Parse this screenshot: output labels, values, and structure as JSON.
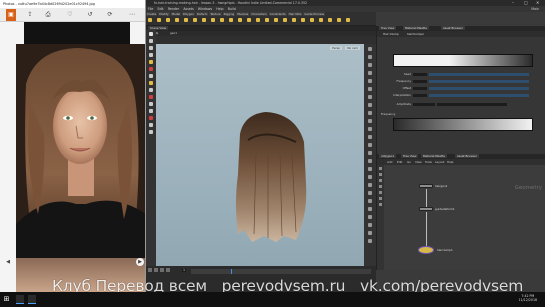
{
  "photos": {
    "title": "Photos - vuttu7ae9e7b44c8d02694202e01c92494.jpg",
    "window_buttons": [
      "–",
      "□",
      "✕"
    ],
    "toolbar_icons": [
      "folder-icon",
      "share-icon",
      "print-icon",
      "heart-icon",
      "undo-icon",
      "rotate-icon",
      "more-icon"
    ],
    "nav": [
      "◀",
      "▶"
    ]
  },
  "houdini": {
    "title": "fx-hair-training-making-hair - lesson-3 - hwngrhipb - Houdini Indie Limited-Commercial 17.0.352",
    "window_buttons": [
      "–",
      "□",
      "✕"
    ],
    "menu": [
      "File",
      "Edit",
      "Render",
      "Assets",
      "Windows",
      "Help",
      "Build"
    ],
    "menu_right": "Main",
    "shelf_tabs": [
      "Create",
      "Modify",
      "Model",
      "Polygon",
      "Deform",
      "Texture",
      "Rigging",
      "Muscles",
      "Characters",
      "Constraints",
      "Hair Utils",
      "Guide Process",
      "Guide Brushes",
      "Terrain FX",
      "Simple FX",
      "Volume"
    ],
    "viewport": {
      "tab": "Scene View",
      "path": "obj",
      "path_node": "geo1",
      "persp_label": "Persp",
      "cam_label": "No cam"
    },
    "timeline": {
      "frame": "1",
      "buttons": [
        "⏮",
        "◀",
        "▶",
        "⏭"
      ]
    },
    "params": {
      "tabs": [
        "Tree View",
        "Material Palette",
        "Asset Browser"
      ],
      "node_type": "Hair Clump",
      "node_name": "hairClumpsl",
      "rows": [
        {
          "label": "Seed",
          "value": "0"
        },
        {
          "label": "Frequency",
          "value": "1"
        },
        {
          "label": "Offset",
          "value": "0"
        },
        {
          "label": "Interpolation",
          "value": "Linear"
        },
        {
          "label": "Amplitude",
          "value": "0.35"
        }
      ],
      "section": "Frequency"
    },
    "network": {
      "tabs": [
        "/obj/geo1",
        "Tree View",
        "Material Palette",
        "Asset Browser"
      ],
      "toolbar": [
        "Add",
        "Edit",
        "Go",
        "View",
        "Tools",
        "Layout",
        "Help"
      ],
      "context_label": "Geometry",
      "nodes": [
        {
          "name": "hairgen1",
          "color": "#8c8c8c"
        },
        {
          "name": "guidedeform1",
          "color": "#8c8c8c"
        },
        {
          "name": "hairclump1",
          "color": "#d9b84a"
        }
      ]
    }
  },
  "taskbar": {
    "clock_time": "7:42 PM",
    "clock_date": "11/12/2018"
  },
  "watermark": {
    "parts": [
      "Клуб Перевод всем",
      "perevodvsem.ru",
      "vk.com/perevodvsem"
    ]
  }
}
